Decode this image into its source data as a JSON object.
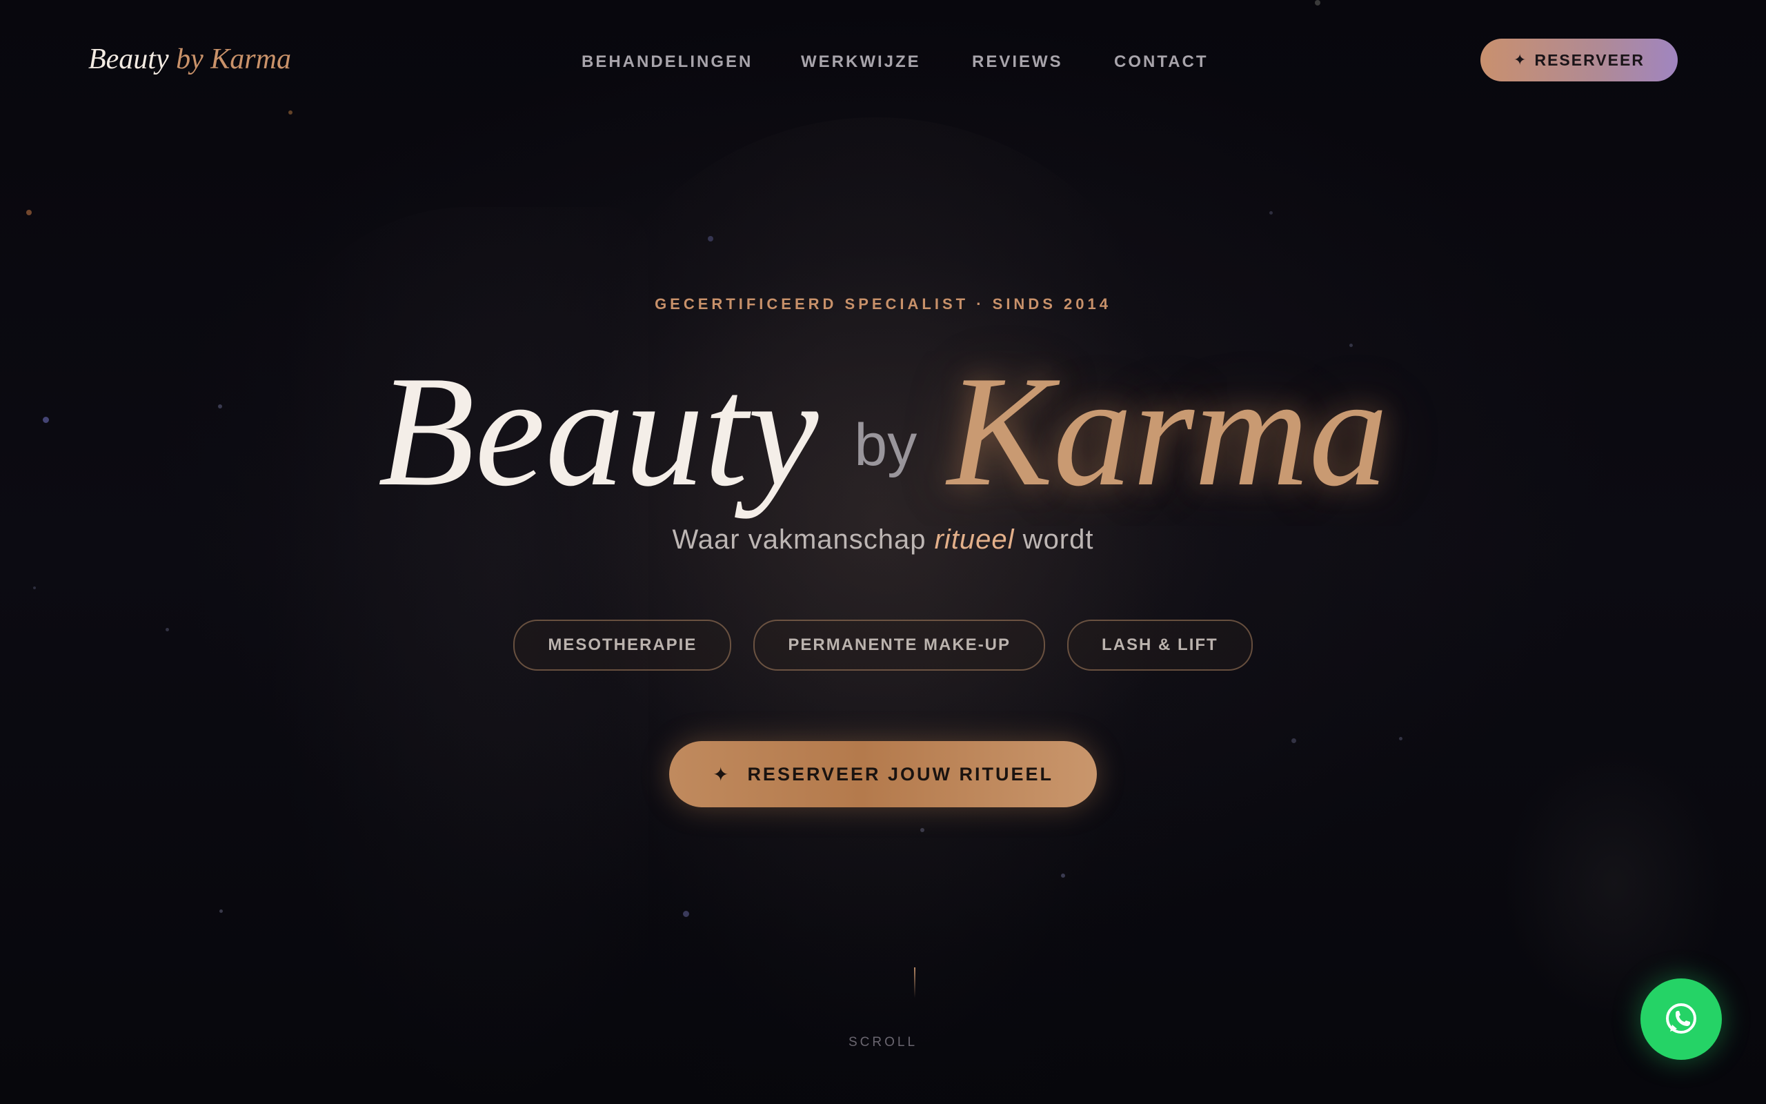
{
  "nav": {
    "logo": {
      "main": "Beauty",
      "accent": "by Karma"
    },
    "links": [
      "BEHANDELINGEN",
      "WERKWIJZE",
      "REVIEWS",
      "CONTACT"
    ],
    "cta_label": "RESERVEER",
    "cta_icon": "sparkle-icon"
  },
  "hero": {
    "eyebrow": "GECERTIFICEERD SPECIALIST · SINDS 2014",
    "title": {
      "word1": "Beauty",
      "word2": "by",
      "word3": "Karma"
    },
    "tagline": {
      "before": "Waar vakmanschap ",
      "emphasis": "ritueel",
      "after": " wordt"
    },
    "pills": [
      "MESOTHERAPIE",
      "PERMANENTE MAKE-UP",
      "LASH & LIFT"
    ],
    "cta_label": "RESERVEER JOUW RITUEEL",
    "cta_icon": "sparkle-icon"
  },
  "scroll": {
    "label": "SCROLL"
  },
  "floating": {
    "icon": "whatsapp-icon"
  },
  "colors": {
    "background": "#0a0910",
    "accent": "#c9926a",
    "whatsapp": "#25d366",
    "nav_cta_gradient_start": "#c9906e",
    "nav_cta_gradient_end": "#a085c0"
  }
}
